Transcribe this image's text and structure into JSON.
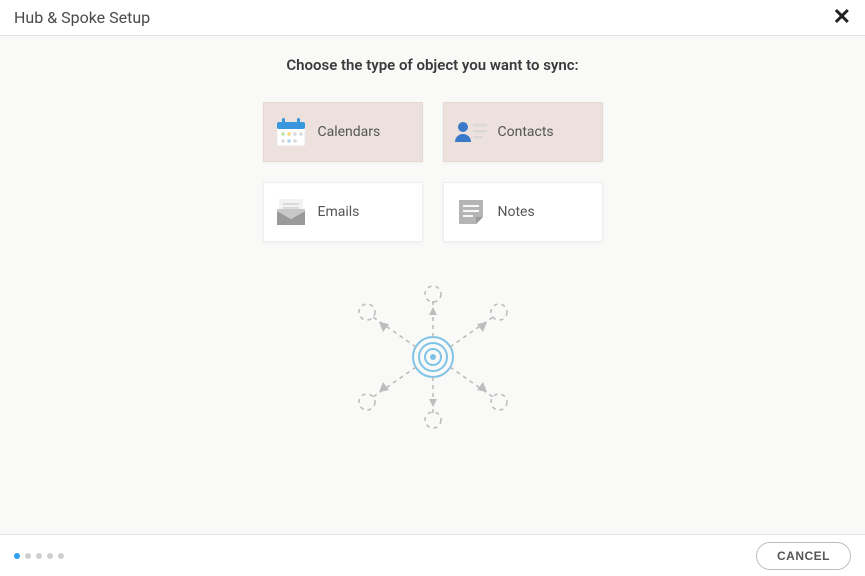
{
  "header": {
    "title": "Hub & Spoke Setup",
    "close_icon": "close-icon"
  },
  "subtitle": "Choose the type of object you want to sync:",
  "options": [
    {
      "label": "Calendars",
      "icon": "calendar-icon",
      "selected": true
    },
    {
      "label": "Contacts",
      "icon": "contact-icon",
      "selected": true
    },
    {
      "label": "Emails",
      "icon": "email-icon",
      "selected": false
    },
    {
      "label": "Notes",
      "icon": "note-icon",
      "selected": false
    }
  ],
  "illustration": "hub-spoke-diagram",
  "progress": {
    "current": 1,
    "total": 5
  },
  "footer": {
    "cancel_label": "CANCEL"
  },
  "colors": {
    "accent": "#2ea0f0",
    "selected_card_bg": "#ece1dd"
  }
}
